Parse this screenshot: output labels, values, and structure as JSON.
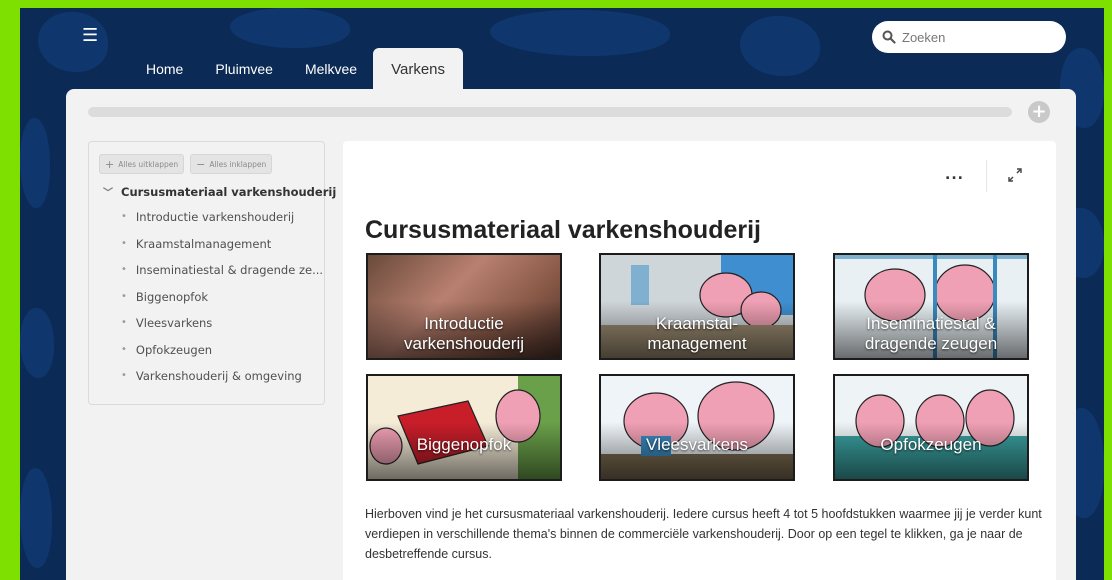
{
  "header": {
    "menu_icon": "hamburger-icon",
    "tabs": [
      {
        "label": "Home"
      },
      {
        "label": "Pluimvee"
      },
      {
        "label": "Melkvee"
      },
      {
        "label": "Varkens",
        "active": true
      }
    ],
    "search": {
      "placeholder": "Zoeken",
      "icon": "search-icon"
    }
  },
  "sidebar": {
    "expand_all": "Alles uitklappen",
    "collapse_all": "Alles inklappen",
    "title": "Cursusmateriaal varkenshouderij",
    "items": [
      {
        "label": "Introductie varkenshouderij"
      },
      {
        "label": "Kraamstalmanagement"
      },
      {
        "label": "Inseminatiestal & dragende ze..."
      },
      {
        "label": "Biggenopfok"
      },
      {
        "label": "Vleesvarkens"
      },
      {
        "label": "Opfokzeugen"
      },
      {
        "label": "Varkenshouderij & omgeving"
      }
    ]
  },
  "content": {
    "more_label": "...",
    "title": "Cursusmateriaal varkenshouderij",
    "tiles": [
      {
        "line1": "Introductie",
        "line2": "varkenshouderij"
      },
      {
        "line1": "Kraamstal-",
        "line2": "management"
      },
      {
        "line1": "Inseminatiestal &",
        "line2": "dragende zeugen"
      },
      {
        "line1": "Biggenopfok"
      },
      {
        "line1": "Vleesvarkens"
      },
      {
        "line1": "Opfokzeugen"
      }
    ],
    "description": "Hierboven vind je het cursusmateriaal varkenshouderij. Iedere cursus heeft 4 tot 5 hoofdstukken waarmee jij je verder kunt verdiepen in verschillende thema's binnen de commerciële varkenshouderij. Door op een tegel te klikken, ga je naar de desbetreffende cursus."
  },
  "colors": {
    "frame_border": "#7ee000",
    "background": "#0b2a56",
    "panel": "#f2f2f2",
    "pig_pink": "#f0a0b4"
  }
}
